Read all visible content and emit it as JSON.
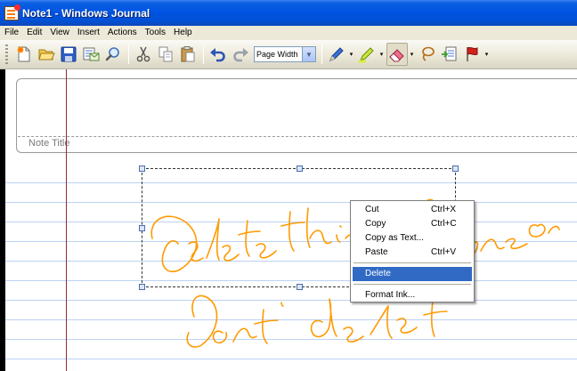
{
  "window": {
    "title": "Note1 - Windows Journal"
  },
  "menu": [
    "File",
    "Edit",
    "View",
    "Insert",
    "Actions",
    "Tools",
    "Help"
  ],
  "toolbar": {
    "zoom_value": "Page Width",
    "buttons": [
      "new-note-icon",
      "open-folder-icon",
      "save-disk-icon",
      "send-mail-icon",
      "find-icon",
      "cut-icon",
      "copy-icon",
      "paste-icon",
      "undo-icon",
      "redo-icon",
      "pen-icon",
      "highlighter-icon",
      "eraser-icon",
      "lasso-icon",
      "insert-space-icon",
      "flag-icon"
    ]
  },
  "note": {
    "title_placeholder": "Note Title"
  },
  "context_menu": {
    "items": [
      {
        "label": "Cut",
        "shortcut": "Ctrl+X"
      },
      {
        "label": "Copy",
        "shortcut": "Ctrl+C"
      },
      {
        "label": "Copy as Text...",
        "shortcut": ""
      },
      {
        "label": "Paste",
        "shortcut": "Ctrl+V"
      }
    ],
    "delete_label": "Delete",
    "format_label": "Format Ink..."
  },
  "colors": {
    "title_bar": "#0054e3",
    "ink": "#ff9a00",
    "rule_line": "#bcd1f3",
    "margin_line": "#8a2a3c",
    "menu_highlight": "#316ac5"
  }
}
